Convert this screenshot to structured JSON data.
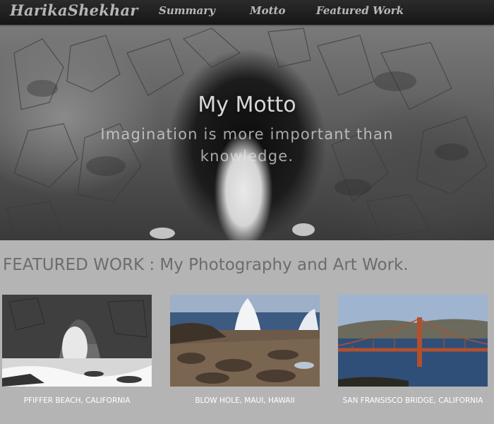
{
  "nav": {
    "brand": "HarikaShekhar",
    "links": [
      "Summary",
      "Motto",
      "Featured Work"
    ]
  },
  "hero": {
    "title": "My Motto",
    "quote": "Imagination is more important than knowledge."
  },
  "featured": {
    "heading": "FEATURED WORK : My Photography and Art Work.",
    "items": [
      {
        "caption": "PFIFFER BEACH, CALIFORNIA"
      },
      {
        "caption": "BLOW HOLE, MAUI, HAWAII"
      },
      {
        "caption": "SAN FRANSISCO BRIDGE, CALIFORNIA"
      }
    ]
  },
  "colors": {
    "nav_bg": "#1f1f1f",
    "page_bg": "#b4b4b4",
    "heading_text": "#6c6c6c",
    "bridge": "#b0502f"
  }
}
